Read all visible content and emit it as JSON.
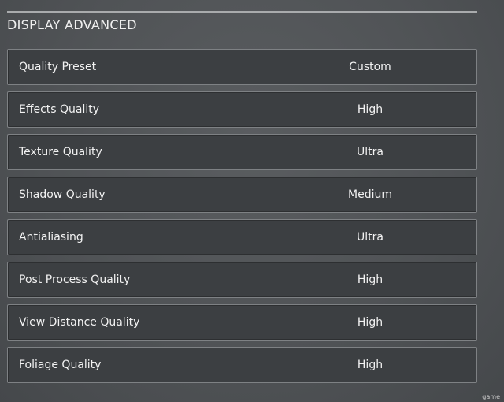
{
  "section": {
    "title": "DISPLAY ADVANCED"
  },
  "settings": [
    {
      "label": "Quality Preset",
      "value": "Custom"
    },
    {
      "label": "Effects Quality",
      "value": "High"
    },
    {
      "label": "Texture Quality",
      "value": "Ultra"
    },
    {
      "label": "Shadow Quality",
      "value": "Medium"
    },
    {
      "label": "Antialiasing",
      "value": "Ultra"
    },
    {
      "label": "Post Process Quality",
      "value": "High"
    },
    {
      "label": "View Distance Quality",
      "value": "High"
    },
    {
      "label": "Foliage Quality",
      "value": "High"
    }
  ],
  "watermark": "game",
  "colors": {
    "background": "#505356",
    "row_background": "#3c3f42",
    "row_border": "#7e8184",
    "text": "#f2f2f2"
  }
}
